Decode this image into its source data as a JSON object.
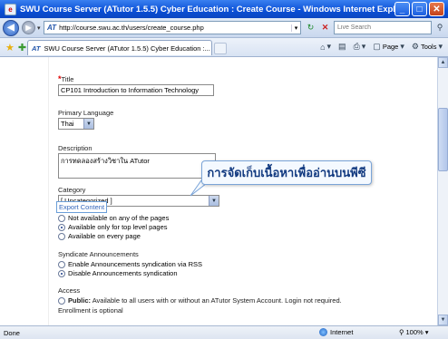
{
  "window": {
    "title": "SWU Course Server (ATutor 1.5.5) Cyber Education : Create Course - Windows Internet Explorer",
    "icon_name": "ie-icon"
  },
  "address_bar": {
    "url": "http://course.swu.ac.th/users/create_course.php",
    "search_placeholder": "Live Search"
  },
  "tab": {
    "label": "SWU Course Server (ATutor 1.5.5) Cyber Education :..."
  },
  "command_bar": {
    "page_label": "Page",
    "tools_label": "Tools"
  },
  "form": {
    "title_label": "Title",
    "title_value": "CP101 Introduction to Information Technology",
    "language_label": "Primary Language",
    "language_value": "Thai",
    "description_label": "Description",
    "description_value": "การทดลองสร้างวิชาใน ATutor",
    "category_label": "Category",
    "category_value": "[ Uncategorized ]",
    "export_label": "Export Content",
    "export_options": [
      {
        "label": "Not available on any of the pages",
        "checked": false
      },
      {
        "label": "Available only for top level pages",
        "checked": true
      },
      {
        "label": "Available on every page",
        "checked": false
      }
    ],
    "syndicate_label": "Syndicate Announcements",
    "syndicate_options": [
      {
        "label": "Enable Announcements syndication via RSS",
        "checked": false
      },
      {
        "label": "Disable Announcements syndication",
        "checked": true
      }
    ],
    "access_label": "Access",
    "access_public_bold": "Public:",
    "access_public_text": "Available to all users with or without an ATutor System Account. Login not required.",
    "access_enrollment_text": "Enrollment is optional"
  },
  "callout": {
    "text": "การจัดเก็บเนื้อหาเพื่ออ่านบนพีซี"
  },
  "status_bar": {
    "left_text": "Done",
    "zone": "Internet",
    "zoom": "100%"
  },
  "colors": {
    "titlebar": "#0a4fd6",
    "link": "#3366bb",
    "required": "#e00000"
  }
}
